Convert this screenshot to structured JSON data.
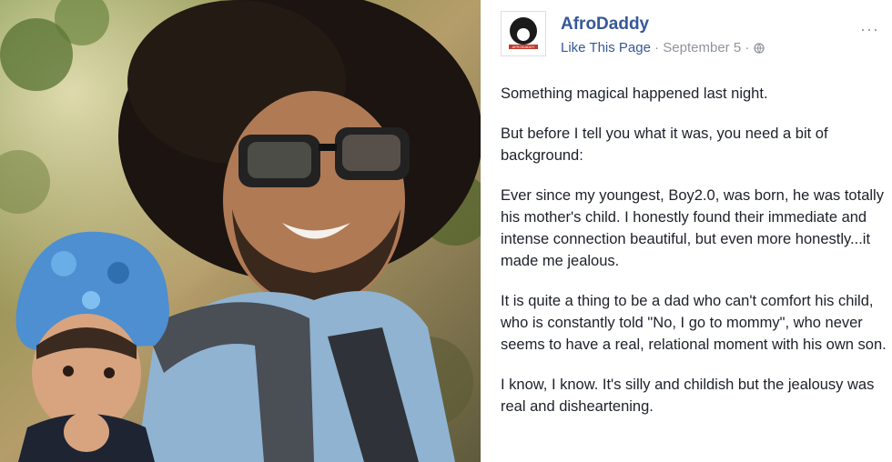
{
  "post": {
    "page_name": "AfroDaddy",
    "like_link": "Like This Page",
    "separator": " · ",
    "date": "September 5",
    "date_separator": " · ",
    "more_glyph": "···",
    "avatar_text": "AFRODADDY",
    "paragraphs": [
      "Something magical happened last night.",
      "But before I tell you what it was, you need a bit of background:",
      "Ever since my youngest, Boy2.0, was born, he was totally his mother's child. I honestly found their immediate and intense connection beautiful, but even more honestly...it made me jealous.",
      "It is quite a thing to be a dad who can't comfort his child, who is constantly told \"No, I go to mommy\", who never seems to have a real, relational moment with his own son.",
      "I know, I know. It's silly and childish but the jealousy was real and disheartening."
    ]
  },
  "icons": {
    "avatar": "afro-avatar-icon",
    "audience": "globe-icon",
    "more": "more-options-icon"
  },
  "colors": {
    "link": "#365899",
    "meta": "#90949c",
    "text": "#1d2129"
  }
}
